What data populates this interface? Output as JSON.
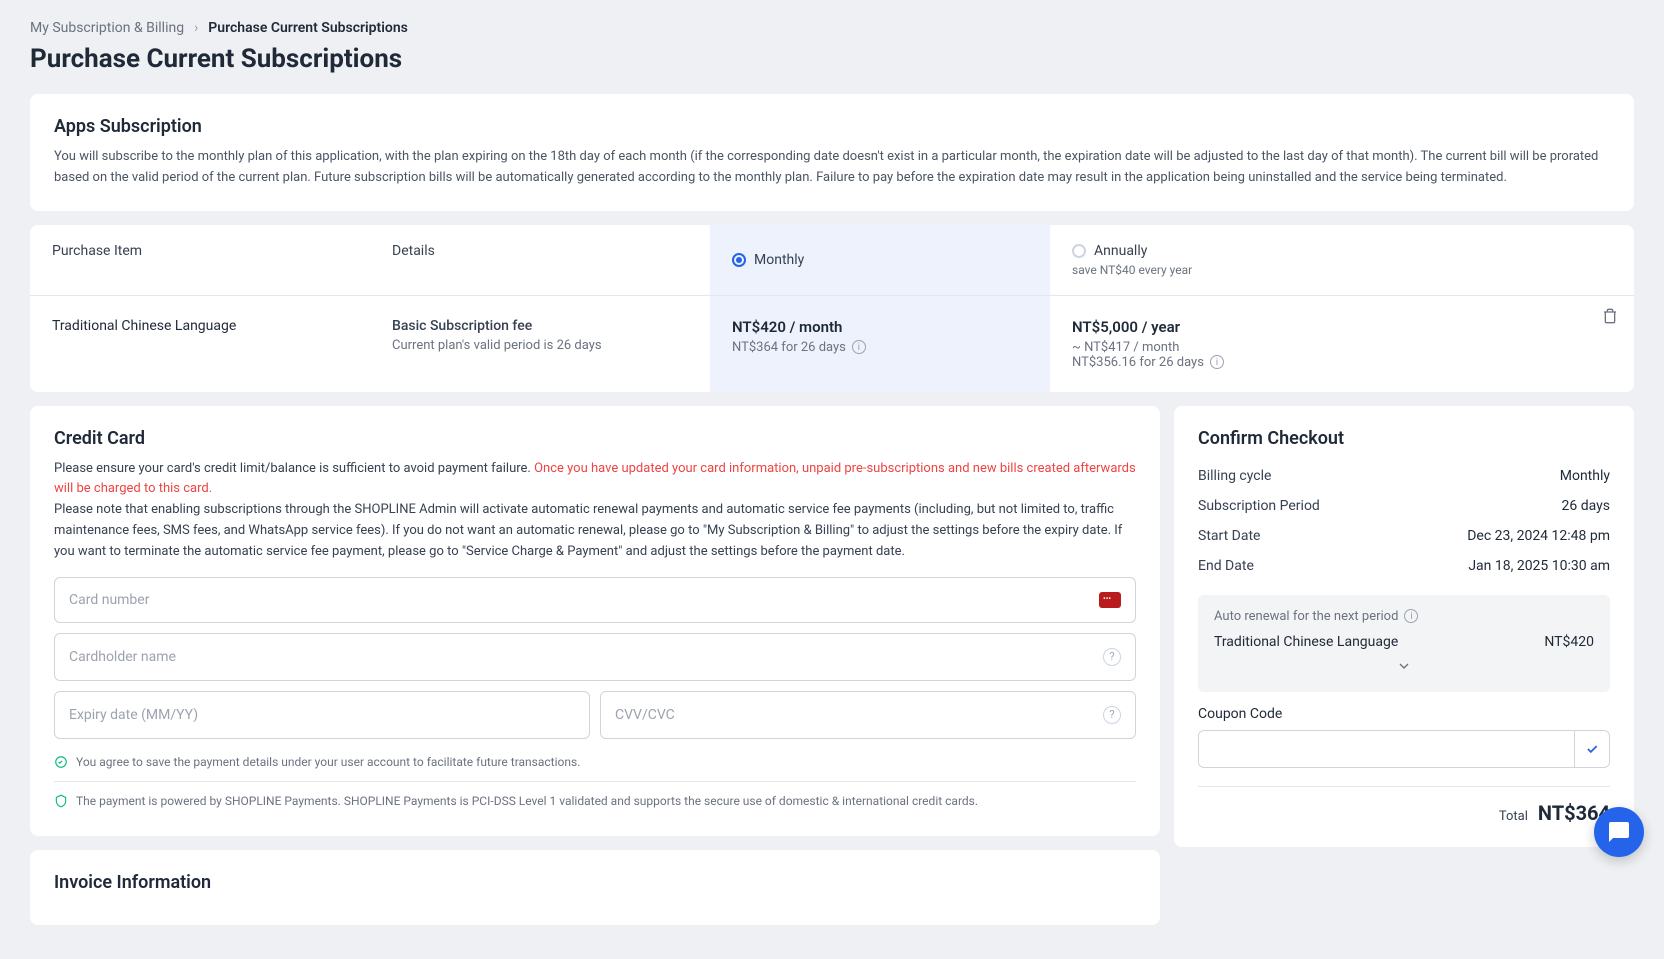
{
  "breadcrumb": {
    "parent": "My Subscription & Billing",
    "current": "Purchase Current Subscriptions"
  },
  "page_title": "Purchase Current Subscriptions",
  "apps_sub": {
    "heading": "Apps Subscription",
    "desc": "You will subscribe to the monthly plan of this application, with the plan expiring on the 18th day of each month (if the corresponding date doesn't exist in a particular month, the expiration date will be adjusted to the last day of that month). The current bill will be prorated based on the valid period of the current plan. Future subscription bills will be automatically generated according to the monthly plan. Failure to pay before the expiration date may result in the application being uninstalled and the service being terminated."
  },
  "plan_table": {
    "col_purchase": "Purchase Item",
    "col_details": "Details",
    "col_monthly": "Monthly",
    "col_annually": "Annually",
    "annual_save": "save NT$40 every year",
    "row": {
      "item": "Traditional Chinese Language",
      "details_line1": "Basic Subscription fee",
      "details_line2": "Current plan's valid period is 26 days",
      "monthly_price": "NT$420 / month",
      "monthly_sub": "NT$364 for 26 days",
      "annual_price": "NT$5,000 / year",
      "annual_sub1": "~ NT$417 / month",
      "annual_sub2": "NT$356.16 for 26 days"
    }
  },
  "credit_card": {
    "heading": "Credit Card",
    "desc_1": "Please ensure your card's credit limit/balance is sufficient to avoid payment failure. ",
    "desc_warn": "Once you have updated your card information, unpaid pre-subscriptions and new bills created afterwards will be charged to this card.",
    "desc_2": "Please note that enabling subscriptions through the SHOPLINE Admin will activate automatic renewal payments and automatic service fee payments (including, but not limited to, traffic maintenance fees, SMS fees, and WhatsApp service fees). If you do not want an automatic renewal, please go to \"My Subscription & Billing\" to adjust the settings before the expiry date. If you want to terminate the automatic service fee payment, please go to \"Service Charge & Payment\" and adjust the settings before the payment date.",
    "ph_card": "Card number",
    "ph_name": "Cardholder name",
    "ph_expiry": "Expiry date (MM/YY)",
    "ph_cvv": "CVV/CVC",
    "helper1": "You agree to save the payment details under your user account to facilitate future transactions.",
    "helper2": "The payment is powered by SHOPLINE Payments. SHOPLINE Payments is PCI-DSS Level 1 validated and supports the secure use of domestic & international credit cards."
  },
  "invoice": {
    "heading": "Invoice Information"
  },
  "checkout": {
    "heading": "Confirm Checkout",
    "rows": {
      "billing_cycle_l": "Billing cycle",
      "billing_cycle_v": "Monthly",
      "period_l": "Subscription Period",
      "period_v": "26 days",
      "start_l": "Start Date",
      "start_v": "Dec 23, 2024 12:48 pm",
      "end_l": "End Date",
      "end_v": "Jan 18, 2025 10:30 am"
    },
    "renewal_title": "Auto renewal for the next period",
    "renewal_item": "Traditional Chinese Language",
    "renewal_price": "NT$420",
    "coupon_label": "Coupon Code",
    "total_label": "Total",
    "total_value": "NT$364"
  }
}
